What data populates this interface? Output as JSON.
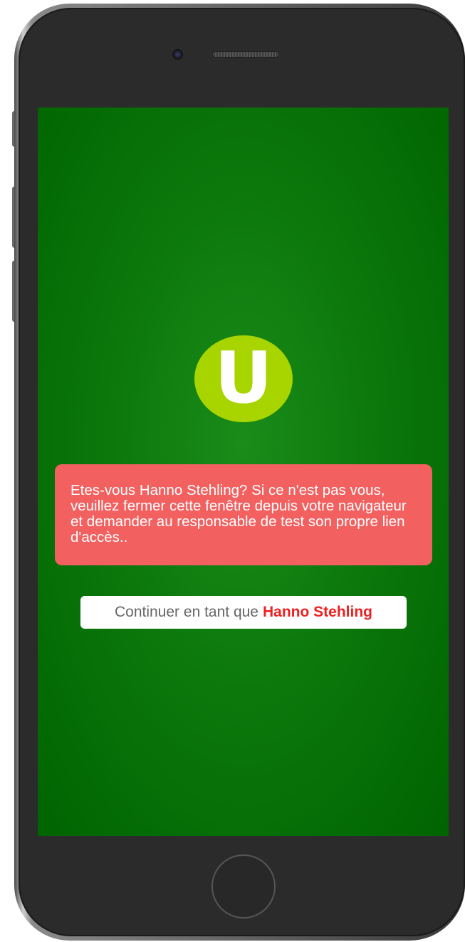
{
  "app": {
    "logo_letter": "U",
    "brand_color": "#a8d400",
    "background_color": "#0d7a0d"
  },
  "warning": {
    "message": "Etes-vous Hanno Stehling? Si ce n'est pas vous, veuillez fermer cette fenêtre depuis votre navigateur et demander au responsable de test son propre lien d'accès..",
    "background_color": "#f26060"
  },
  "continue_button": {
    "prefix": "Continuer en tant que",
    "user_name": "Hanno Stehling",
    "name_color": "#ee2020"
  },
  "device": {
    "camera_icon": "camera-icon",
    "speaker_icon": "speaker-grille-icon",
    "home_icon": "home-button-icon"
  }
}
